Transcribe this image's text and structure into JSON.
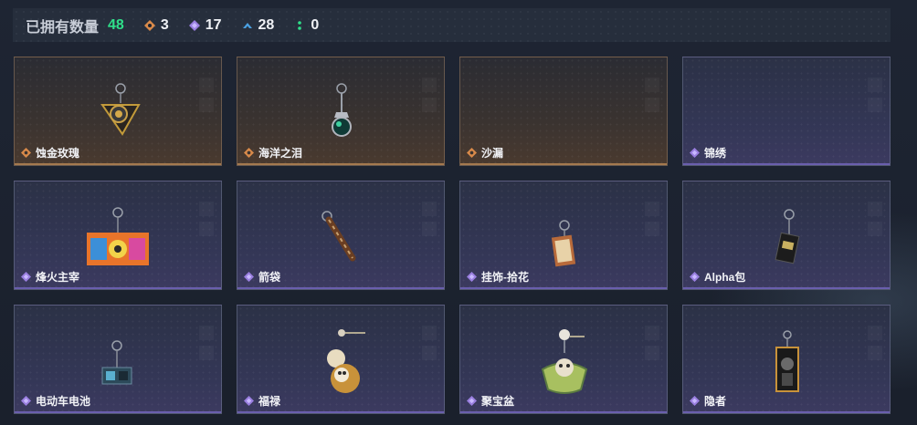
{
  "header": {
    "owned_label": "已拥有数量",
    "owned_count": "48",
    "stats": [
      {
        "icon": "orange-diamond-icon",
        "value": "3",
        "color": "#d98a4a"
      },
      {
        "icon": "purple-diamond-icon",
        "value": "17",
        "color": "#9a7fe0"
      },
      {
        "icon": "blue-chevron-icon",
        "value": "28",
        "color": "#4a9fe0"
      },
      {
        "icon": "green-dots-icon",
        "value": "0",
        "color": "#2fe08a"
      }
    ]
  },
  "items": [
    {
      "name": "蚀金玫瑰",
      "rarity": "orange",
      "icon": "rose-pendant-icon"
    },
    {
      "name": "海洋之泪",
      "rarity": "orange",
      "icon": "tear-pendant-icon"
    },
    {
      "name": "沙漏",
      "rarity": "orange",
      "icon": ""
    },
    {
      "name": "锦绣",
      "rarity": "purple",
      "icon": ""
    },
    {
      "name": "烽火主宰",
      "rarity": "purple",
      "icon": "graffiti-tag-icon"
    },
    {
      "name": "箭袋",
      "rarity": "purple",
      "icon": "quiver-icon"
    },
    {
      "name": "挂饰-拾花",
      "rarity": "purple",
      "icon": "flower-card-icon"
    },
    {
      "name": "Alpha包",
      "rarity": "purple",
      "icon": "alpha-pack-icon"
    },
    {
      "name": "电动车电池",
      "rarity": "purple",
      "icon": "battery-icon"
    },
    {
      "name": "福禄",
      "rarity": "purple",
      "icon": "gourd-icon"
    },
    {
      "name": "聚宝盆",
      "rarity": "purple",
      "icon": "treasure-bowl-icon"
    },
    {
      "name": "隐者",
      "rarity": "purple",
      "icon": "hermit-card-icon"
    }
  ]
}
